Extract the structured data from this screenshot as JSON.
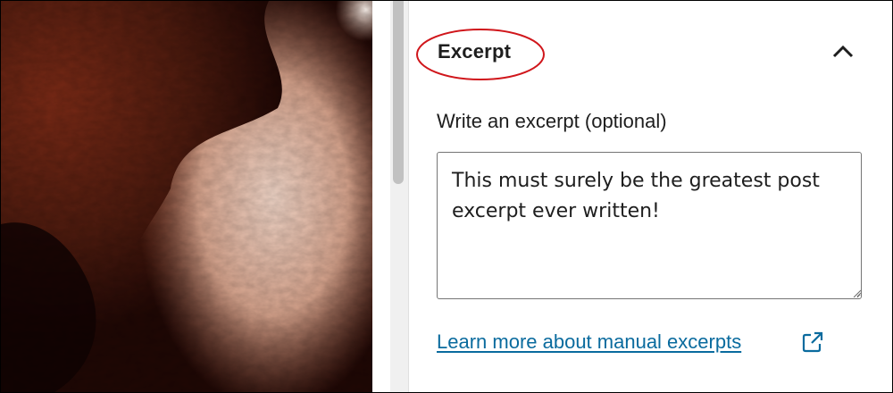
{
  "panel": {
    "title": "Excerpt",
    "toggle_icon": "chevron-up-icon"
  },
  "excerpt": {
    "label": "Write an excerpt (optional)",
    "value": "This must surely be the greatest post excerpt ever written!"
  },
  "help_link": {
    "text": "Learn more about manual excerpts",
    "icon": "external-link-icon"
  },
  "colors": {
    "link": "#0a6b9e",
    "annotation": "#d0161b",
    "border": "#757575",
    "text": "#1e1e1e"
  }
}
